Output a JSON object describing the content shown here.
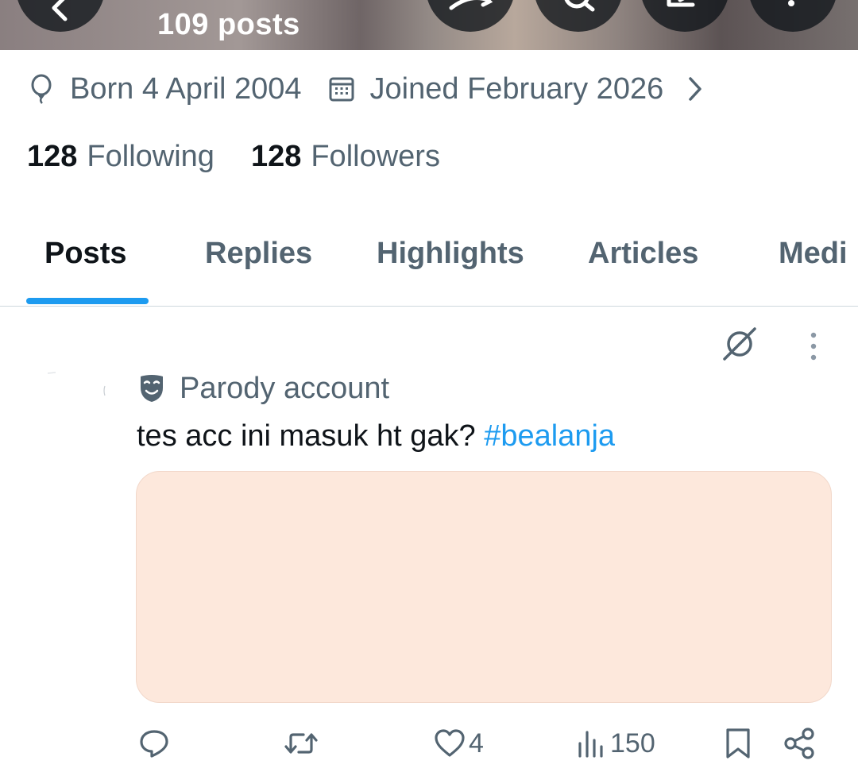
{
  "header": {
    "post_count": "109 posts",
    "buttons": [
      "back-icon",
      "grok-icon",
      "search-icon",
      "edit-icon",
      "more-icon"
    ]
  },
  "profile": {
    "born": "Born 4 April 2004",
    "joined": "Joined February 2026",
    "following_count": "128",
    "following_label": "Following",
    "followers_count": "128",
    "followers_label": "Followers"
  },
  "tabs": [
    {
      "label": "Posts",
      "active": true
    },
    {
      "label": "Replies",
      "active": false
    },
    {
      "label": "Highlights",
      "active": false
    },
    {
      "label": "Articles",
      "active": false
    },
    {
      "label": "Medi",
      "active": false
    }
  ],
  "post": {
    "label": "Parody account",
    "text": "tes acc ini masuk ht gak?",
    "hashtag": "#bealanja",
    "actions": {
      "reply_count": "",
      "repost_count": "",
      "like_count": "4",
      "views_count": "150"
    }
  },
  "colors": {
    "accent": "#1d9bf0",
    "text_primary": "#0f1419",
    "text_secondary": "#536471",
    "media_placeholder": "#fde8dc"
  }
}
